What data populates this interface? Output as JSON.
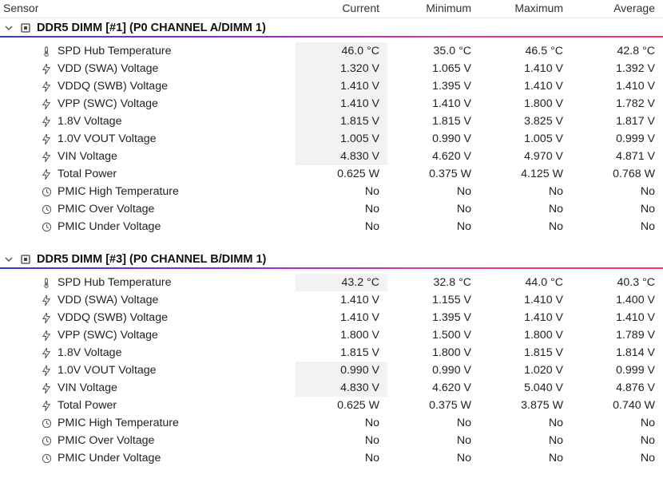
{
  "columns": {
    "sensor": "Sensor",
    "current": "Current",
    "minimum": "Minimum",
    "maximum": "Maximum",
    "average": "Average"
  },
  "groups": [
    {
      "title": "DDR5 DIMM [#1] (P0 CHANNEL A/DIMM 1)",
      "rows": [
        {
          "icon": "temp",
          "label": "SPD Hub Temperature",
          "cur": "46.0 °C",
          "min": "35.0 °C",
          "max": "46.5 °C",
          "avg": "42.8 °C",
          "shade": true
        },
        {
          "icon": "volt",
          "label": "VDD (SWA) Voltage",
          "cur": "1.320 V",
          "min": "1.065 V",
          "max": "1.410 V",
          "avg": "1.392 V",
          "shade": true
        },
        {
          "icon": "volt",
          "label": "VDDQ (SWB) Voltage",
          "cur": "1.410 V",
          "min": "1.395 V",
          "max": "1.410 V",
          "avg": "1.410 V",
          "shade": true
        },
        {
          "icon": "volt",
          "label": "VPP (SWC) Voltage",
          "cur": "1.410 V",
          "min": "1.410 V",
          "max": "1.800 V",
          "avg": "1.782 V",
          "shade": true
        },
        {
          "icon": "volt",
          "label": "1.8V Voltage",
          "cur": "1.815 V",
          "min": "1.815 V",
          "max": "3.825 V",
          "avg": "1.817 V",
          "shade": true
        },
        {
          "icon": "volt",
          "label": "1.0V VOUT Voltage",
          "cur": "1.005 V",
          "min": "0.990 V",
          "max": "1.005 V",
          "avg": "0.999 V",
          "shade": true
        },
        {
          "icon": "volt",
          "label": "VIN Voltage",
          "cur": "4.830 V",
          "min": "4.620 V",
          "max": "4.970 V",
          "avg": "4.871 V",
          "shade": true
        },
        {
          "icon": "volt",
          "label": "Total Power",
          "cur": "0.625 W",
          "min": "0.375 W",
          "max": "4.125 W",
          "avg": "0.768 W",
          "shade": false
        },
        {
          "icon": "clock",
          "label": "PMIC High Temperature",
          "cur": "No",
          "min": "No",
          "max": "No",
          "avg": "No",
          "shade": false
        },
        {
          "icon": "clock",
          "label": "PMIC Over Voltage",
          "cur": "No",
          "min": "No",
          "max": "No",
          "avg": "No",
          "shade": false
        },
        {
          "icon": "clock",
          "label": "PMIC Under Voltage",
          "cur": "No",
          "min": "No",
          "max": "No",
          "avg": "No",
          "shade": false
        }
      ]
    },
    {
      "title": "DDR5 DIMM [#3] (P0 CHANNEL B/DIMM 1)",
      "rows": [
        {
          "icon": "temp",
          "label": "SPD Hub Temperature",
          "cur": "43.2 °C",
          "min": "32.8 °C",
          "max": "44.0 °C",
          "avg": "40.3 °C",
          "shade": true
        },
        {
          "icon": "volt",
          "label": "VDD (SWA) Voltage",
          "cur": "1.410 V",
          "min": "1.155 V",
          "max": "1.410 V",
          "avg": "1.400 V",
          "shade": false
        },
        {
          "icon": "volt",
          "label": "VDDQ (SWB) Voltage",
          "cur": "1.410 V",
          "min": "1.395 V",
          "max": "1.410 V",
          "avg": "1.410 V",
          "shade": false
        },
        {
          "icon": "volt",
          "label": "VPP (SWC) Voltage",
          "cur": "1.800 V",
          "min": "1.500 V",
          "max": "1.800 V",
          "avg": "1.789 V",
          "shade": false
        },
        {
          "icon": "volt",
          "label": "1.8V Voltage",
          "cur": "1.815 V",
          "min": "1.800 V",
          "max": "1.815 V",
          "avg": "1.814 V",
          "shade": false
        },
        {
          "icon": "volt",
          "label": "1.0V VOUT Voltage",
          "cur": "0.990 V",
          "min": "0.990 V",
          "max": "1.020 V",
          "avg": "0.999 V",
          "shade": true
        },
        {
          "icon": "volt",
          "label": "VIN Voltage",
          "cur": "4.830 V",
          "min": "4.620 V",
          "max": "5.040 V",
          "avg": "4.876 V",
          "shade": true
        },
        {
          "icon": "volt",
          "label": "Total Power",
          "cur": "0.625 W",
          "min": "0.375 W",
          "max": "3.875 W",
          "avg": "0.740 W",
          "shade": false
        },
        {
          "icon": "clock",
          "label": "PMIC High Temperature",
          "cur": "No",
          "min": "No",
          "max": "No",
          "avg": "No",
          "shade": false
        },
        {
          "icon": "clock",
          "label": "PMIC Over Voltage",
          "cur": "No",
          "min": "No",
          "max": "No",
          "avg": "No",
          "shade": false
        },
        {
          "icon": "clock",
          "label": "PMIC Under Voltage",
          "cur": "No",
          "min": "No",
          "max": "No",
          "avg": "No",
          "shade": false
        }
      ]
    }
  ]
}
